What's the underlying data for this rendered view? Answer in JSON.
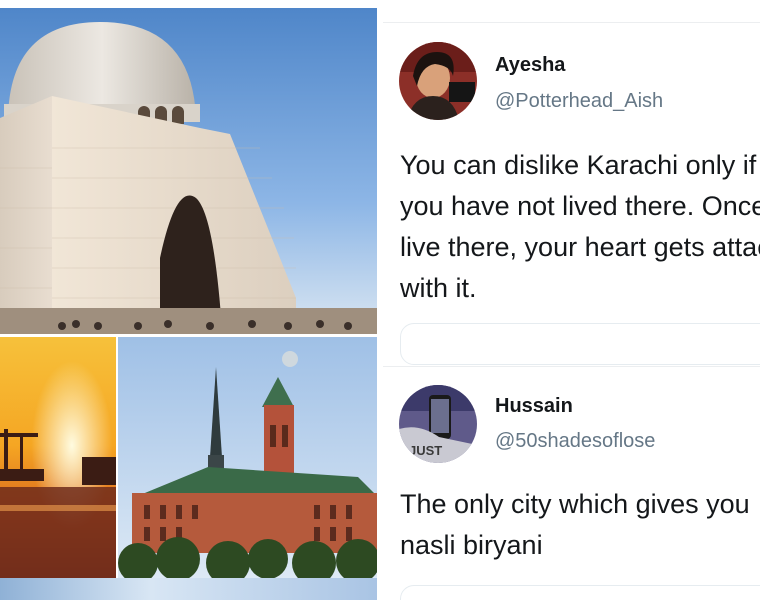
{
  "collage": {
    "photos": [
      {
        "subject": "white domed mausoleum under blue sky"
      },
      {
        "subject": "orange sunset over harbour cranes"
      },
      {
        "subject": "red brick clock tower building with spire"
      }
    ]
  },
  "tweets": [
    {
      "name": "Ayesha",
      "handle": "@Potterhead_Aish",
      "avatar_icon": "user-avatar-photo",
      "lines": [
        "You can dislike Karachi only if",
        "you have not lived there. Once you",
        "live there, your heart gets attached",
        "with it."
      ]
    },
    {
      "name": "Hussain",
      "handle": "@50shadesoflose",
      "avatar_icon": "user-avatar-photo",
      "lines": [
        "The only city which gives you",
        "nasli biryani"
      ]
    }
  ],
  "colors": {
    "text": "#14171a",
    "secondary": "#657786",
    "divider": "#eceef0"
  }
}
